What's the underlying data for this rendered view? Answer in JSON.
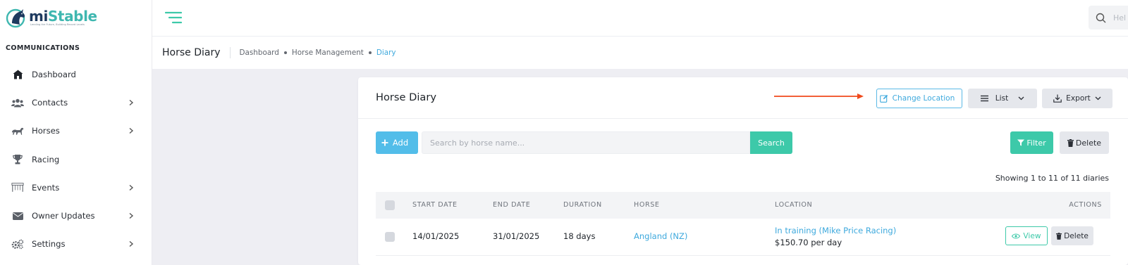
{
  "brand": {
    "name_part1": "mi",
    "name_part2": "Stable",
    "tagline": "Lending the Future, Building Record Levels"
  },
  "sidebar": {
    "section_title": "COMMUNICATIONS",
    "items": [
      {
        "label": "Dashboard",
        "icon": "home-icon",
        "has_children": false
      },
      {
        "label": "Contacts",
        "icon": "users-icon",
        "has_children": true
      },
      {
        "label": "Horses",
        "icon": "horse-icon",
        "has_children": true
      },
      {
        "label": "Racing",
        "icon": "trophy-icon",
        "has_children": false
      },
      {
        "label": "Events",
        "icon": "gate-icon",
        "has_children": true
      },
      {
        "label": "Owner Updates",
        "icon": "envelope-icon",
        "has_children": true
      },
      {
        "label": "Settings",
        "icon": "gears-icon",
        "has_children": true
      }
    ]
  },
  "header": {
    "search_placeholder": "Hel"
  },
  "subheader": {
    "title": "Horse Diary",
    "breadcrumb": [
      "Dashboard",
      "Horse Management",
      "Diary"
    ]
  },
  "card": {
    "title": "Horse Diary",
    "change_location_label": "Change Location",
    "list_label": "List",
    "export_label": "Export",
    "add_label": "Add",
    "search_placeholder": "Search by horse name...",
    "search_button_label": "Search",
    "filter_label": "Filter",
    "delete_label": "Delete",
    "showing_text": "Showing 1 to 11 of 11 diaries"
  },
  "table": {
    "columns": [
      "START DATE",
      "END DATE",
      "DURATION",
      "HORSE",
      "LOCATION",
      "ACTIONS"
    ],
    "rows": [
      {
        "start_date": "14/01/2025",
        "end_date": "31/01/2025",
        "duration": "18 days",
        "horse": "Angland (NZ)",
        "location": "In training (Mike Price Racing)",
        "rate": "$150.70 per day",
        "view_label": "View",
        "delete_label": "Delete"
      }
    ]
  },
  "colors": {
    "accent_blue": "#3ea9dd",
    "accent_teal": "#3dc9a9",
    "add_button": "#52bde9",
    "annotation_arrow": "#f04a1c"
  }
}
